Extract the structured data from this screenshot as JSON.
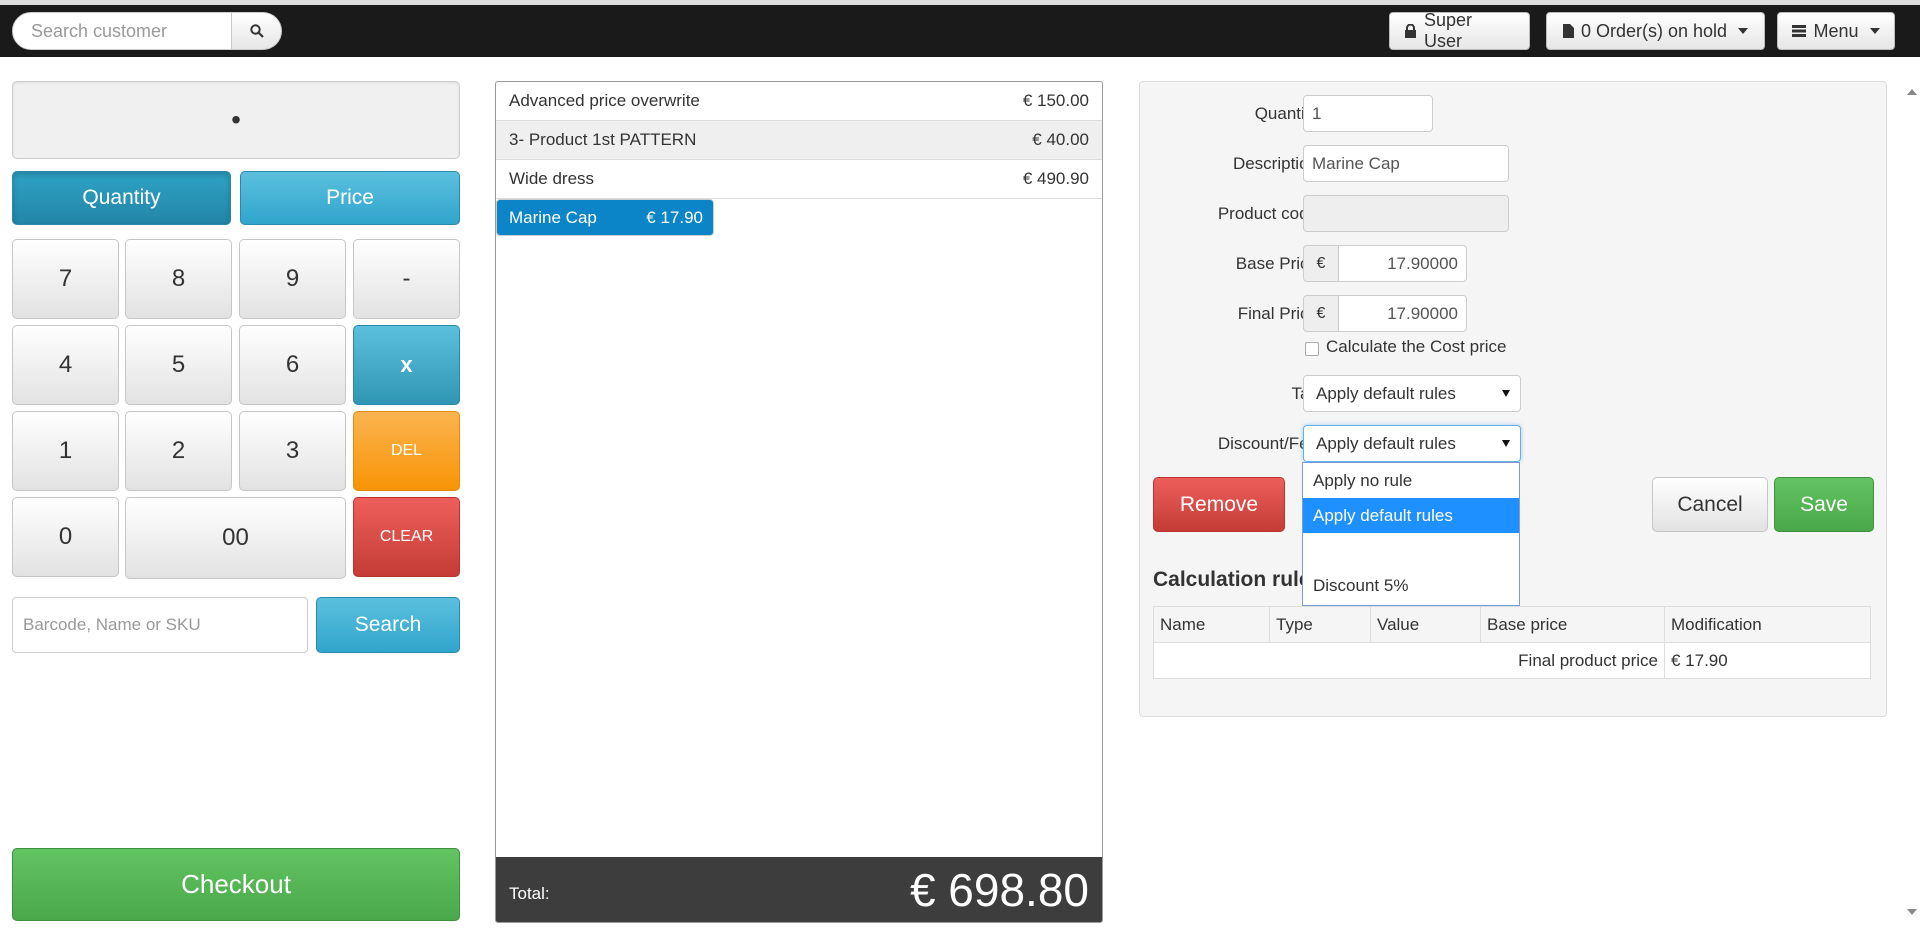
{
  "topnav": {
    "search_placeholder": "Search customer",
    "user_label": "Super User",
    "orders_label": "0 Order(s) on hold",
    "menu_label": "Menu"
  },
  "keypad": {
    "display_value": "•",
    "mode_quantity": "Quantity",
    "mode_price": "Price",
    "keys": [
      "7",
      "8",
      "9",
      "-",
      "4",
      "5",
      "6",
      "x",
      "1",
      "2",
      "3",
      "DEL",
      "0",
      "00",
      "CLEAR"
    ],
    "barcode_placeholder": "Barcode, Name or SKU",
    "search_label": "Search",
    "checkout_label": "Checkout"
  },
  "order": {
    "items": [
      {
        "name": "Advanced price overwrite",
        "price": "€ 150.00"
      },
      {
        "name": "3- Product 1st PATTERN",
        "price": "€ 40.00"
      },
      {
        "name": "Wide dress",
        "price": "€ 490.90"
      },
      {
        "name": "Marine Cap",
        "price": "€ 17.90"
      }
    ],
    "selected_index": 3,
    "total_label": "Total:",
    "total_value": "€ 698.80"
  },
  "form": {
    "quantity_label": "Quantity",
    "quantity_value": "1",
    "description_label": "Description",
    "description_value": "Marine Cap",
    "product_code_label": "Product code",
    "product_code_value": "",
    "base_price_label": "Base Price",
    "currency_symbol": "€",
    "base_price_value": "17.90000",
    "final_price_label": "Final Price",
    "final_price_value": "17.90000",
    "cost_price_checkbox_label": "Calculate the Cost price",
    "cost_price_checked": false,
    "tax_label": "Tax",
    "tax_value": "Apply default rules",
    "discount_label": "Discount/Fee",
    "discount_value": "Apply default rules",
    "discount_options": [
      "Apply no rule",
      "Apply default rules",
      "",
      "Discount 5%"
    ],
    "discount_options_active_index": 1,
    "remove_label": "Remove",
    "cancel_label": "Cancel",
    "save_label": "Save"
  },
  "calculation": {
    "title": "Calculation rules",
    "columns": [
      "Name",
      "Type",
      "Value",
      "Base price",
      "Modification"
    ],
    "final_label": "Final product price",
    "final_value": "€ 17.90"
  },
  "colors": {
    "primary_info": "#5bc0de",
    "selected_row": "#0b85c8",
    "success": "#5bb75b",
    "danger": "#da4f49",
    "warning": "#f89406",
    "topbar": "#1a1a1a"
  }
}
